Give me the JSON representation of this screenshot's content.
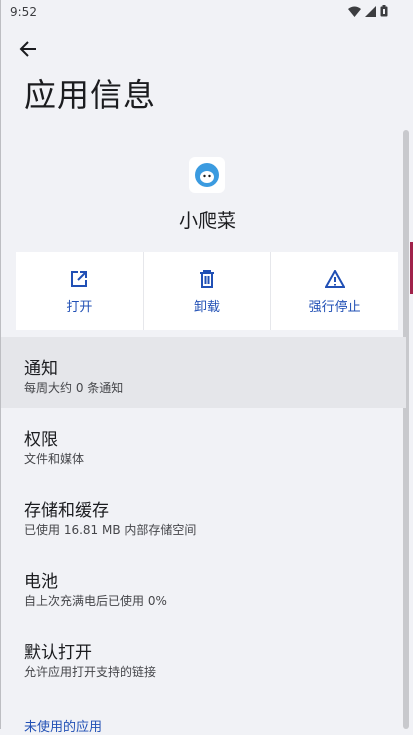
{
  "status_bar": {
    "time": "9:52"
  },
  "header": {
    "title": "应用信息"
  },
  "app": {
    "name": "小爬菜"
  },
  "actions": [
    {
      "label": "打开",
      "icon": "open-in-new-icon"
    },
    {
      "label": "卸载",
      "icon": "trash-icon"
    },
    {
      "label": "强行停止",
      "icon": "warning-icon"
    }
  ],
  "settings": [
    {
      "title": "通知",
      "summary": "每周大约 0 条通知"
    },
    {
      "title": "权限",
      "summary": "文件和媒体"
    },
    {
      "title": "存储和缓存",
      "summary": "已使用 16.81 MB 内部存储空间"
    },
    {
      "title": "电池",
      "summary": "自上次充满电后已使用 0%"
    },
    {
      "title": "默认打开",
      "summary": "允许应用打开支持的链接"
    }
  ],
  "section": {
    "unused_apps": "未使用的应用"
  },
  "colors": {
    "accent": "#2150b5",
    "background": "#f1f2f6"
  }
}
